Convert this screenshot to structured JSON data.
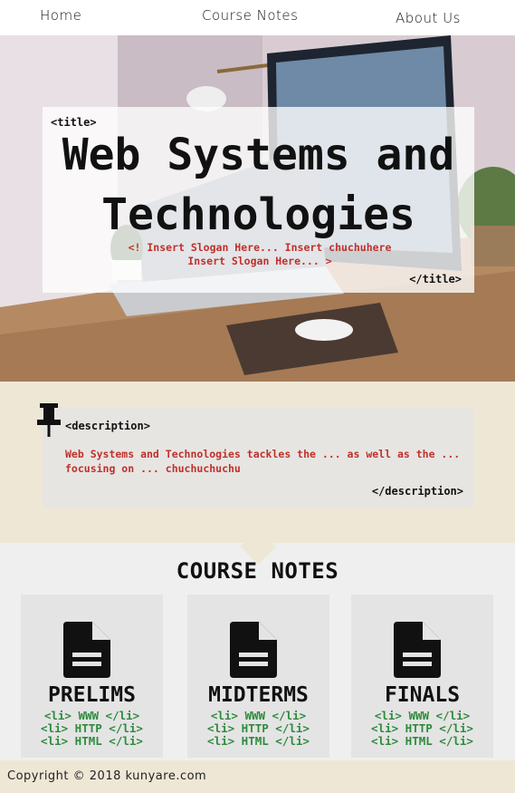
{
  "nav": {
    "home": "Home",
    "course_notes": "Course Notes",
    "about": "About Us"
  },
  "hero": {
    "tag_open": "<title>",
    "title_line1": "Web Systems and",
    "title_line2": "Technologies",
    "slogan_line1": "<! Insert Slogan Here... Insert chuchuhere",
    "slogan_line2": "Insert Slogan Here... >",
    "tag_close": "</title>"
  },
  "description": {
    "tag_open": "<description>",
    "text": "Web Systems and Technologies tackles the ... as well as the ... focusing on ... chuchuchuchu",
    "tag_close": "</description>"
  },
  "notes": {
    "heading": "COURSE NOTES",
    "cards": [
      {
        "title": "PRELIMS",
        "items": [
          "<li> WWW </li>",
          "<li> HTTP </li>",
          "<li> HTML </li>"
        ]
      },
      {
        "title": "MIDTERMS",
        "items": [
          "<li> WWW </li>",
          "<li> HTTP </li>",
          "<li> HTML </li>"
        ]
      },
      {
        "title": "FINALS",
        "items": [
          "<li> WWW </li>",
          "<li> HTTP </li>",
          "<li> HTML </li>"
        ]
      }
    ]
  },
  "footer": {
    "copyright": "Copyright © 2018 kunyare.com"
  },
  "colors": {
    "accent_red": "#c0302b",
    "list_green": "#2e8b3c",
    "beige": "#efe7d6"
  },
  "icons": [
    "pushpin-icon",
    "document-icon"
  ]
}
